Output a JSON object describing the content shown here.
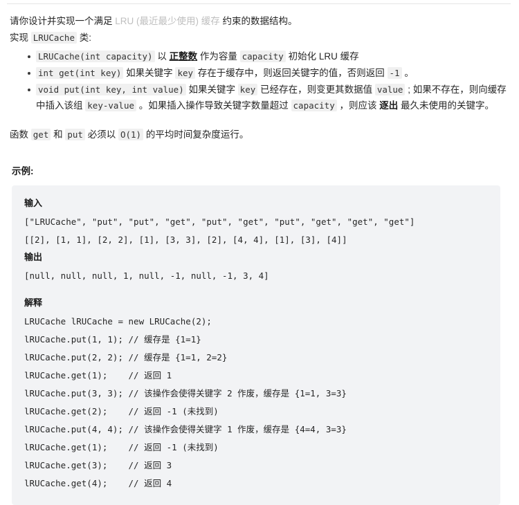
{
  "problem": {
    "intro_prefix": "请你设计并实现一个满足 ",
    "intro_link": "LRU (最近最少使用) 缓存",
    "intro_suffix": " 约束的数据结构。",
    "implement_prefix": "实现 ",
    "implement_code": "LRUCache",
    "implement_suffix": " 类:",
    "bullets": [
      {
        "code1": "LRUCache(int capacity)",
        "t1": " 以 ",
        "bold_underline": "正整数",
        "t2": " 作为容量 ",
        "code2": "capacity",
        "t3": " 初始化 LRU 缓存"
      },
      {
        "code1": "int get(int key)",
        "t1": " 如果关键字 ",
        "code2": "key",
        "t2": " 存在于缓存中，则返回关键字的值，否则返回 ",
        "code3": "-1",
        "t3": " 。"
      },
      {
        "code1": "void put(int key, int value)",
        "t1": " 如果关键字 ",
        "code2": "key",
        "t2": " 已经存在，则变更其数据值 ",
        "code3": "value",
        "t3": " ; 如果不存在，则向缓存中插入该组 ",
        "code4": "key-value",
        "t4": " 。如果插入操作导致关键字数量超过 ",
        "code5": "capacity",
        "t5": " ，则应该 ",
        "bold": "逐出",
        "t6": " 最久未使用的关键字。"
      }
    ],
    "complexity": {
      "prefix": "函数 ",
      "code1": "get",
      "mid1": " 和 ",
      "code2": "put",
      "mid2": " 必须以 ",
      "code3": "O(1)",
      "suffix": " 的平均时间复杂度运行。"
    }
  },
  "example": {
    "heading": "示例:",
    "input_label": "输入",
    "input_lines": [
      "[\"LRUCache\", \"put\", \"put\", \"get\", \"put\", \"get\", \"put\", \"get\", \"get\", \"get\"]",
      "[[2], [1, 1], [2, 2], [1], [3, 3], [2], [4, 4], [1], [3], [4]]"
    ],
    "output_label": "输出",
    "output_lines": [
      "[null, null, null, 1, null, -1, null, -1, 3, 4]"
    ],
    "explanation_label": "解释",
    "explanation_lines": [
      "LRUCache lRUCache = new LRUCache(2);",
      "lRUCache.put(1, 1); // 缓存是 {1=1}",
      "lRUCache.put(2, 2); // 缓存是 {1=1, 2=2}",
      "lRUCache.get(1);    // 返回 1",
      "lRUCache.put(3, 3); // 该操作会使得关键字 2 作废，缓存是 {1=1, 3=3}",
      "lRUCache.get(2);    // 返回 -1 (未找到)",
      "lRUCache.put(4, 4); // 该操作会使得关键字 1 作废，缓存是 {4=4, 3=3}",
      "lRUCache.get(1);    // 返回 -1 (未找到)",
      "lRUCache.get(3);    // 返回 3",
      "lRUCache.get(4);    // 返回 4"
    ]
  },
  "colors": {
    "code_block_bg": "#f2f3f5",
    "inline_code_bg": "#f0f0f0",
    "muted_link": "#bfbfbf",
    "text": "#262626"
  }
}
